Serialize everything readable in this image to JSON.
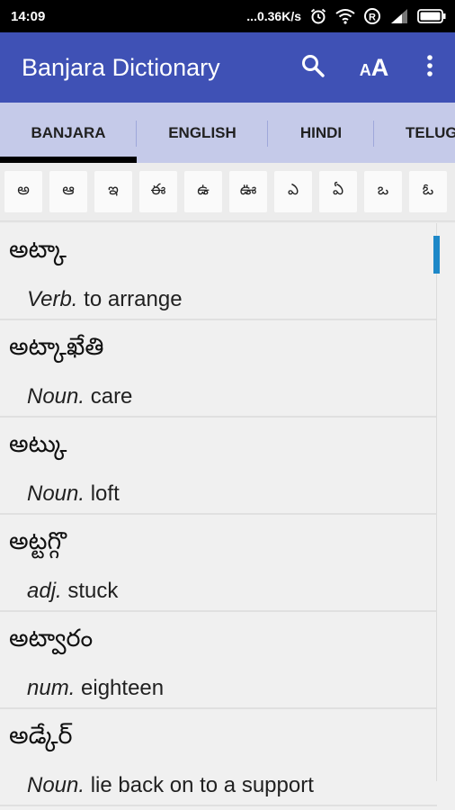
{
  "status_bar": {
    "time": "14:09",
    "network_speed": "...0.36K/s",
    "icons": [
      "alarm-icon",
      "wifi-icon",
      "registered-icon",
      "signal-icon",
      "battery-icon"
    ]
  },
  "app_bar": {
    "title": "Banjara Dictionary",
    "background": "#3f51b5",
    "actions": [
      "search-icon",
      "font-size-icon",
      "more-vert-icon"
    ]
  },
  "tabs": [
    {
      "label": "BANJARA",
      "active": true
    },
    {
      "label": "ENGLISH",
      "active": false
    },
    {
      "label": "HINDI",
      "active": false
    },
    {
      "label": "TELUGU",
      "active": false
    }
  ],
  "alphabet": [
    "అ",
    "ఆ",
    "ఇ",
    "ఈ",
    "ఉ",
    "ఊ",
    "ఎ",
    "ఏ",
    "ఒ",
    "ఓ"
  ],
  "entries": [
    {
      "word": "అట్కా",
      "pos": "Verb.",
      "meaning": "to arrange"
    },
    {
      "word": "అట్కాఖేతి",
      "pos": "Noun.",
      "meaning": "care"
    },
    {
      "word": "అట్కు",
      "pos": "Noun.",
      "meaning": "loft"
    },
    {
      "word": "అట్టగ్గొ",
      "pos": "adj.",
      "meaning": "stuck"
    },
    {
      "word": "అట్వారం",
      "pos": "num.",
      "meaning": "eighteen"
    },
    {
      "word": "అడ్కేర్",
      "pos": "Noun.",
      "meaning": "lie back on to a support"
    }
  ],
  "colors": {
    "primary": "#3f51b5",
    "tab_bar": "#c5cae9",
    "scroll_accent": "#1e88c8"
  }
}
